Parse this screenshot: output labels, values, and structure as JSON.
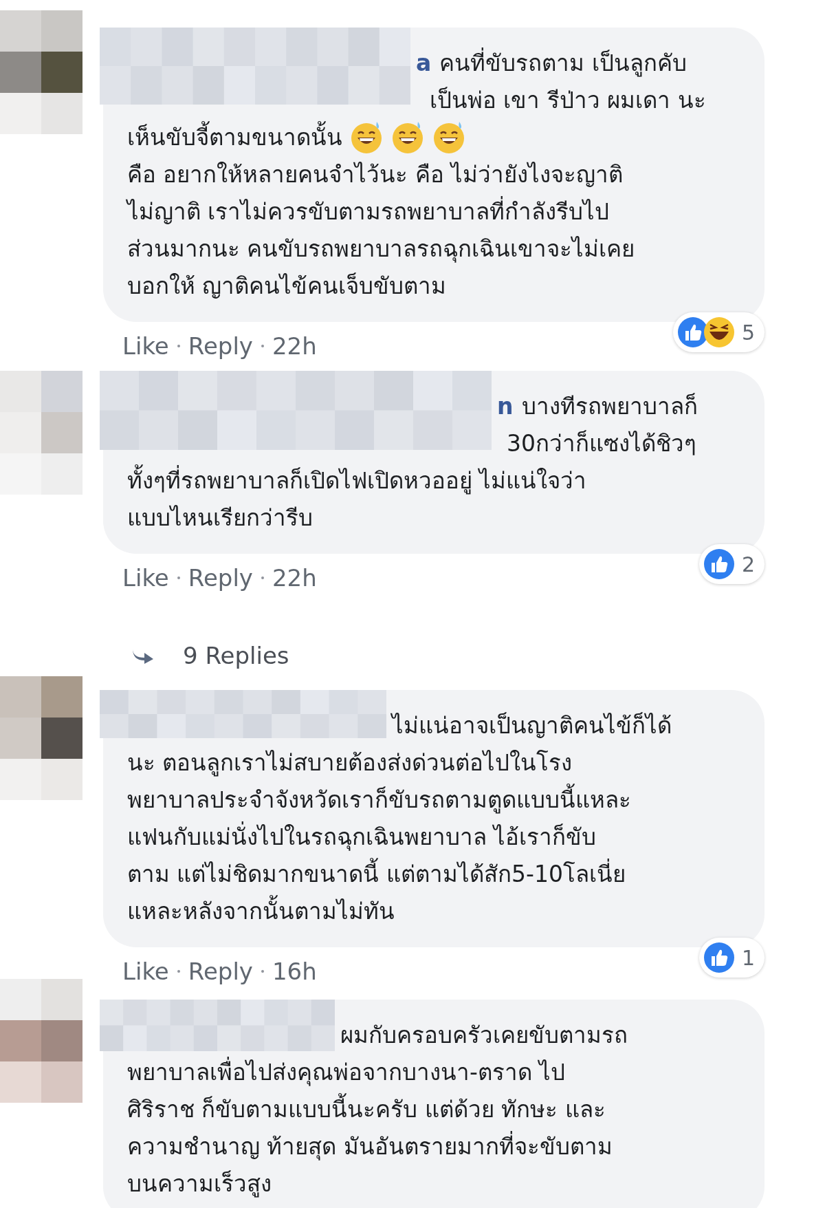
{
  "comments": [
    {
      "author_tail": "a",
      "lines": [
        {
          "kind": "first",
          "text": "คนที่ขับรถตาม เป็นลูกคับ"
        },
        {
          "kind": "partial",
          "text": "เป็นพ่อ เขา รีป่าว ผมเดา นะ"
        },
        {
          "kind": "plain",
          "text": "เห็นขับจี้ตามขนาดนั้น",
          "icons": [
            {
              "kind": "grin-sweat"
            },
            {
              "kind": "grin-sweat"
            },
            {
              "kind": "grin-sweat"
            }
          ]
        },
        {
          "kind": "plain",
          "text": "คือ อยากให้หลายคนจำไว้นะ คือ ไม่ว่ายังไงจะญาติ"
        },
        {
          "kind": "plain",
          "text": "ไม่ญาติ เราไม่ควรขับตามรถพยาบาลที่กำลังรีบไป"
        },
        {
          "kind": "plain",
          "text": "ส่วนมากนะ คนขับรถพยาบาลรถฉุกเฉินเขาจะไม่เคย"
        },
        {
          "kind": "plain",
          "text": "บอกให้ ญาติคนไข้คนเจ็บขับตาม"
        }
      ],
      "reactions": {
        "icons": [
          {
            "kind": "like"
          },
          {
            "kind": "haha"
          }
        ],
        "count": "5"
      },
      "actions": [
        "Like",
        "Reply"
      ],
      "time": "22h"
    },
    {
      "author_tail": "n",
      "lines": [
        {
          "kind": "first",
          "text": "บางทีรถพยาบาลก็"
        },
        {
          "kind": "partial",
          "text": "30กว่าก็แซงได้ชิวๆ"
        },
        {
          "kind": "plain",
          "text": "ทั้งๆที่รถพยาบาลก็เปิดไฟเปิดหวออยู่ ไม่แน่ใจว่า"
        },
        {
          "kind": "plain",
          "text": "แบบไหนเรียกว่ารีบ"
        }
      ],
      "reactions": {
        "icons": [
          {
            "kind": "like"
          }
        ],
        "count": "2"
      },
      "actions": [
        "Like",
        "Reply"
      ],
      "time": "22h",
      "replies_link": "9 Replies"
    },
    {
      "lines": [
        {
          "kind": "first",
          "text": "ไม่แน่อาจเป็นญาติคนไข้ก็ได้"
        },
        {
          "kind": "plain",
          "text": "นะ ตอนลูกเราไม่สบายต้องส่งด่วนต่อไปในโรง"
        },
        {
          "kind": "plain",
          "text": "พยาบาลประจำจังหวัดเราก็ขับรถตามตูดแบบนี้แหละ"
        },
        {
          "kind": "plain",
          "text": "แฟนกับแม่นั่งไปในรถฉุกเฉินพยาบาล ไอ้เราก็ขับ"
        },
        {
          "kind": "plain",
          "text": "ตาม แต่ไม่ชิดมากขนาดนี้ แต่ตามได้สัก5-10โลเนี่ย"
        },
        {
          "kind": "plain",
          "text": "แหละหลังจากนั้นตามไม่ทัน"
        }
      ],
      "reactions": {
        "icons": [
          {
            "kind": "like"
          }
        ],
        "count": "1"
      },
      "actions": [
        "Like",
        "Reply"
      ],
      "time": "16h"
    },
    {
      "lines": [
        {
          "kind": "first",
          "text": "ผมกับครอบครัวเคยขับตามรถ"
        },
        {
          "kind": "plain",
          "text": "พยาบาลเพื่อไปส่งคุณพ่อจากบางนา-ตราด ไป"
        },
        {
          "kind": "plain",
          "text": "ศิริราช ก็ขับตามแบบนี้นะครับ แต่ด้วย ทักษะ และ"
        },
        {
          "kind": "plain",
          "text": "ความชำนาญ ท้ายสุด มันอันตรายมากที่จะขับตาม"
        },
        {
          "kind": "plain",
          "text": "บนความเร็วสูง"
        }
      ]
    }
  ]
}
